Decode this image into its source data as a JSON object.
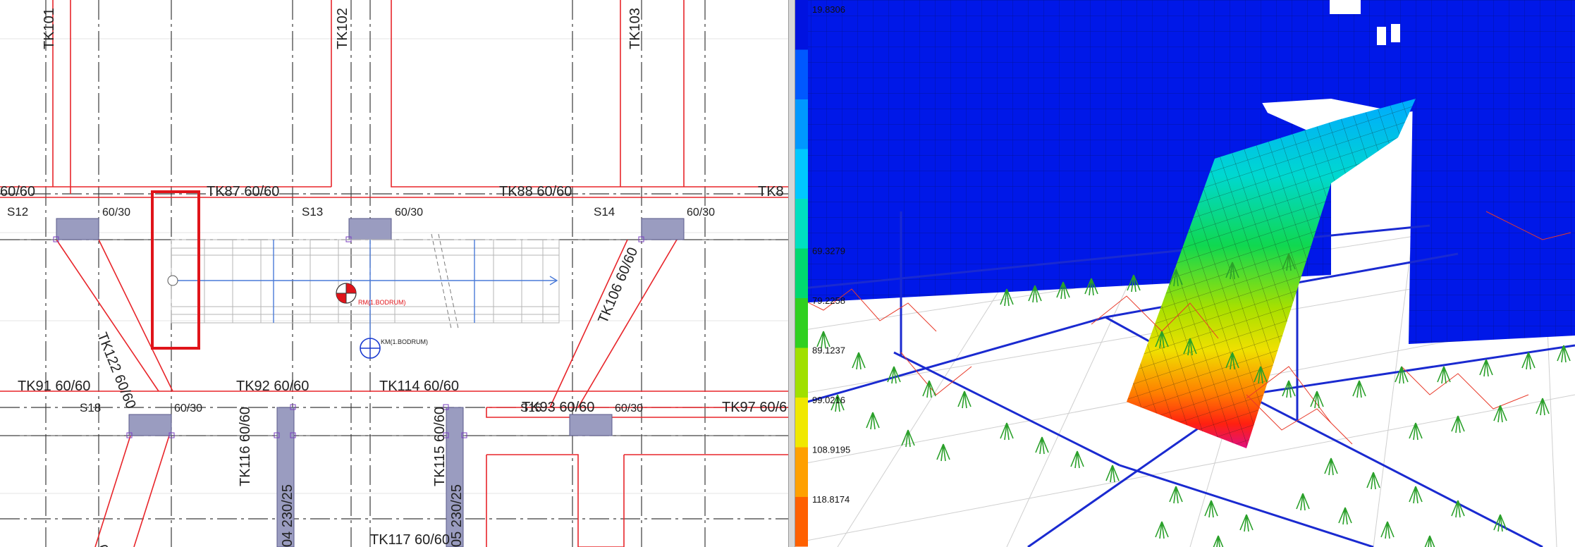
{
  "plan": {
    "beam_labels_top": [
      "TK101",
      "TK102",
      "TK103"
    ],
    "beam_row1": [
      "60/60",
      "TK87 60/60",
      "TK88 60/60",
      "TK8"
    ],
    "columns_row1": [
      "S12",
      "S13",
      "S14"
    ],
    "column_sizes_row1": [
      "60/30",
      "60/30",
      "60/30"
    ],
    "diagonal_labels": [
      "TK122 60/60",
      "TK106 60/60"
    ],
    "beam_row2": [
      "TK91 60/60",
      "TK92 60/60",
      "TK114 60/60",
      "TK93 60/60",
      "TK97 60/6"
    ],
    "columns_row2": [
      "S18",
      "S15"
    ],
    "column_sizes_row2": [
      "60/30",
      "60/30"
    ],
    "vertical_beams": [
      "TK116 60/60",
      "TK115 60/60"
    ],
    "wall_labels": [
      "04 230/25",
      "05 230/25"
    ],
    "bottom_beam": "TK117 60/60",
    "bottom_left_partial": "0",
    "rm_label": "RM(1.BODRUM)",
    "km_label": "KM(1.BODRUM)"
  },
  "legend": {
    "values": [
      "19.8306",
      "",
      "",
      "",
      "",
      "69.3279",
      "79.2258",
      "89.1237",
      "99.0216",
      "108.9195",
      "118.8174"
    ],
    "colors": [
      "#0012e0",
      "#0058ff",
      "#0098ff",
      "#00c8ff",
      "#00e0c0",
      "#00d870",
      "#30d020",
      "#a0e000",
      "#f0e800",
      "#ffa000",
      "#ff6000"
    ]
  },
  "colors": {
    "beam_outline": "#e8252a",
    "gridline": "#333333",
    "column_fill": "#9a9cc0",
    "highlight_box": "#e0141a",
    "shell_blue": "#0018e8",
    "spring_green": "#2aa02a",
    "frame_blue": "#1a2ad0"
  }
}
